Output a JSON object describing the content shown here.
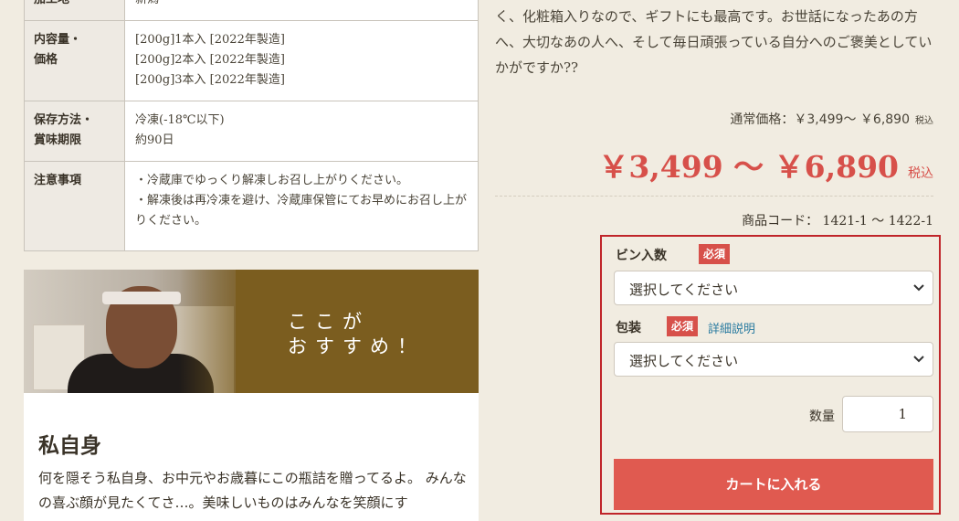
{
  "spec_table": {
    "rows": [
      {
        "label": "加工地",
        "lines": [
          "新潟"
        ]
      },
      {
        "label": "内容量・\n価格",
        "lines": [
          "[200g]1本入 [2022年製造]",
          "[200g]2本入 [2022年製造]",
          "[200g]3本入 [2022年製造]"
        ]
      },
      {
        "label": "保存方法・\n賞味期限",
        "lines": [
          "冷凍(-18℃以下)",
          "約90日"
        ]
      },
      {
        "label": "注意事項",
        "lines": [
          "・冷蔵庫でゆっくり解凍しお召し上がりください。",
          "・解凍後は再冷凍を避け、冷蔵庫保管にてお早めにお召し上がりください。"
        ]
      }
    ]
  },
  "banner": {
    "line1": "ここが",
    "line2": "おすすめ！"
  },
  "story": {
    "title": "私自身",
    "text": "何を隠そう私自身、お中元やお歳暮にこの瓶詰を贈ってるよ。 みんなの喜ぶ顔が見たくてさ…。美味しいものはみんなを笑顔にす"
  },
  "product": {
    "intro": "く、化粧箱入りなので、ギフトにも最高です。お世話になったあの方へ、大切なあの人へ、そして毎日頑張っている自分へのご褒美としていかがですか??",
    "regular_price_label": "通常価格：￥3,499～ ￥6,890",
    "regular_tax": "税込",
    "price": "￥3,499 ～ ￥6,890",
    "price_tax": "税込",
    "code": "商品コード： 1421-1 ～ 1422-1"
  },
  "form": {
    "option1_label": "ビン入数",
    "option2_label": "包装",
    "required": "必須",
    "detail_link": "詳細説明",
    "select_placeholder": "選択してください",
    "qty_label": "数量",
    "qty_value": "1",
    "cart_button": "カートに入れる"
  },
  "colors": {
    "accent_red": "#d7504a",
    "box_border": "#c0252a",
    "banner_brown": "#7b5d1f",
    "link": "#2a7ba0"
  }
}
